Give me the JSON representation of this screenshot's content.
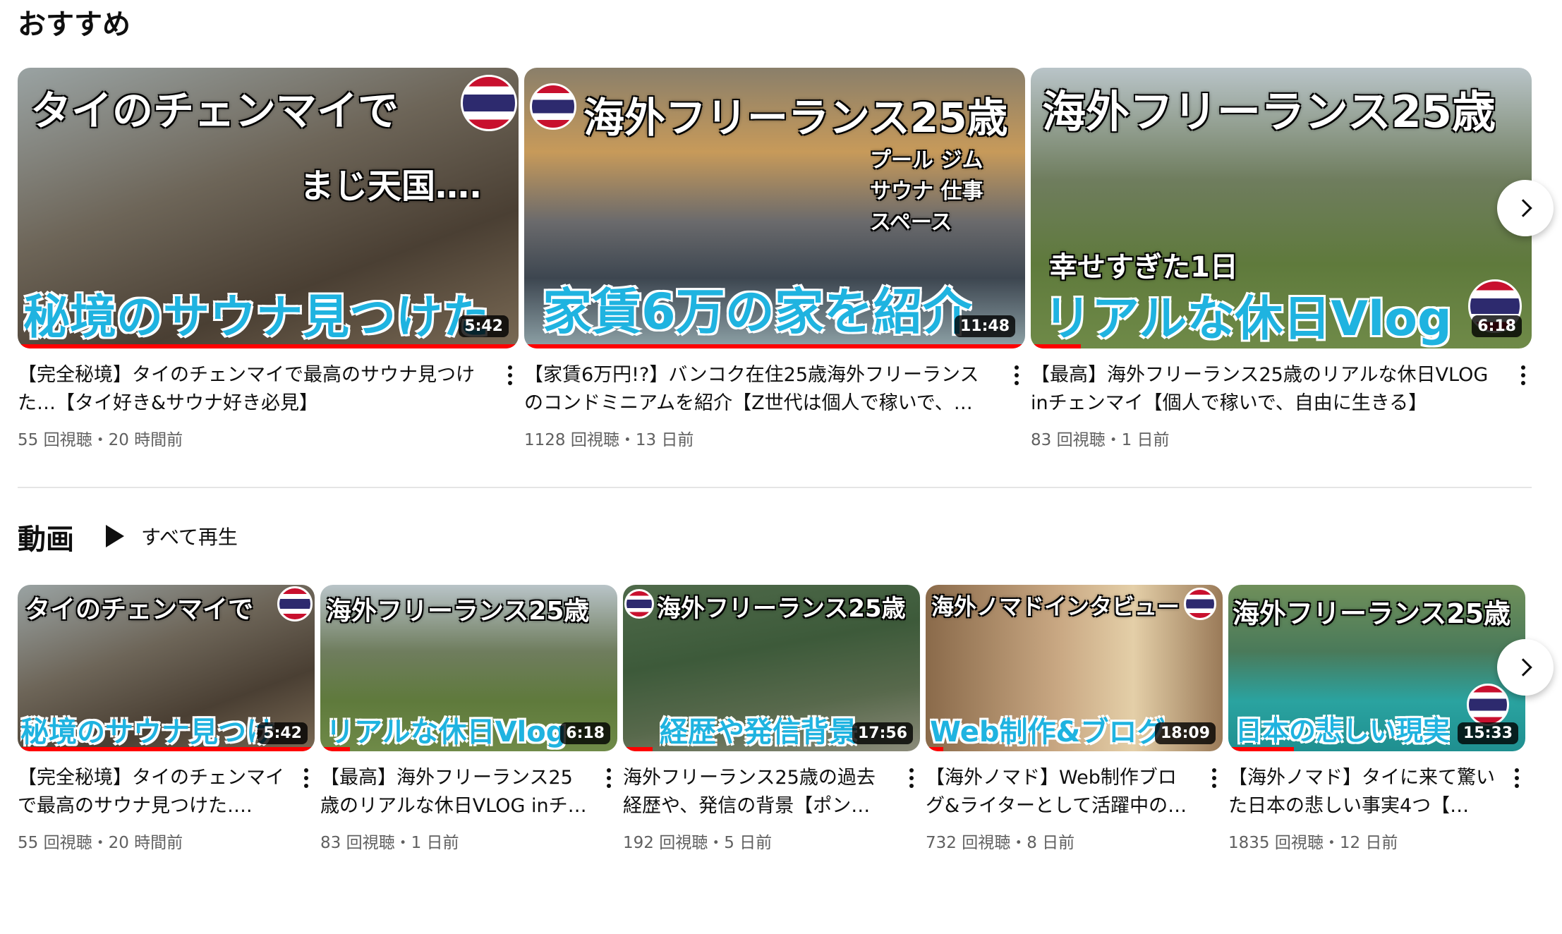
{
  "recommended": {
    "title": "おすすめ",
    "videos": [
      {
        "title": "【完全秘境】タイのチェンマイで最高のサウナ見つけた…【タイ好き&サウナ好き必見】",
        "meta": "55 回視聴・20 時間前",
        "duration": "5:42",
        "thumb_top": "タイのチェンマイで",
        "thumb_mid": "まじ天国….",
        "thumb_bottom": "秘境のサウナ見つけた"
      },
      {
        "title": "【家賃6万円!?】バンコク在住25歳海外フリーランスのコンドミニアムを紹介【Z世代は個人で稼いで、…",
        "meta": "1128 回視聴・13 日前",
        "duration": "11:48",
        "thumb_top": "海外フリーランス25歳",
        "thumb_mid": "プール ジム サウナ 仕事スペース",
        "thumb_bottom": "家賃6万の家を紹介"
      },
      {
        "title": "【最高】海外フリーランス25歳のリアルな休日VLOG inチェンマイ【個人で稼いで、自由に生きる】",
        "meta": "83 回視聴・1 日前",
        "duration": "6:18",
        "thumb_top": "海外フリーランス25歳",
        "thumb_mid": "幸せすぎた1日",
        "thumb_bottom": "リアルな休日Vlog"
      }
    ]
  },
  "videos_section": {
    "title": "動画",
    "play_all": "すべて再生",
    "videos": [
      {
        "title": "【完全秘境】タイのチェンマイで最高のサウナ見つけた….",
        "meta": "55 回視聴・20 時間前",
        "duration": "5:42",
        "thumb_top": "タイのチェンマイで",
        "thumb_bottom": "秘境のサウナ見つけ"
      },
      {
        "title": "【最高】海外フリーランス25歳のリアルな休日VLOG inチ…",
        "meta": "83 回視聴・1 日前",
        "duration": "6:18",
        "thumb_top": "海外フリーランス25歳",
        "thumb_bottom": "リアルな休日Vlog"
      },
      {
        "title": "海外フリーランス25歳の過去経歴や、発信の背景【ポン…",
        "meta": "192 回視聴・5 日前",
        "duration": "17:56",
        "thumb_top": "海外フリーランス25歳",
        "thumb_bottom": "経歴や発信背景"
      },
      {
        "title": "【海外ノマド】Web制作ブログ&ライターとして活躍中の…",
        "meta": "732 回視聴・8 日前",
        "duration": "18:09",
        "thumb_top": "海外ノマドインタビュー",
        "thumb_bottom": "Web制作&ブログ"
      },
      {
        "title": "【海外ノマド】タイに来て驚いた日本の悲しい事実4つ【…",
        "meta": "1835 回視聴・12 日前",
        "duration": "15:33",
        "thumb_top": "海外フリーランス25歳",
        "thumb_bottom": "日本の悲しい現実"
      }
    ]
  },
  "colors": {
    "accent": "#ff0000",
    "meta_text": "#606060",
    "divider": "#e5e5e5"
  }
}
